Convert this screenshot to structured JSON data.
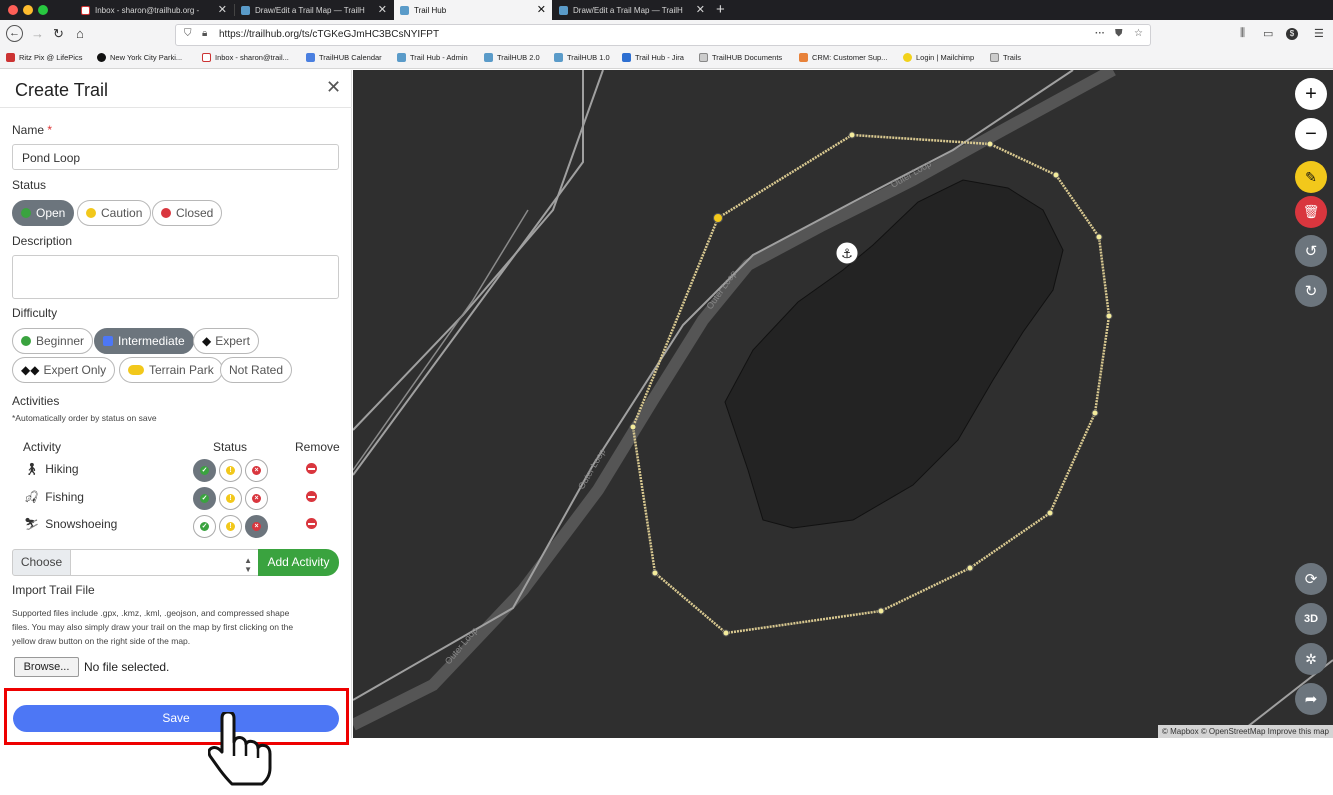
{
  "browser": {
    "tabs": [
      {
        "title": "Inbox - sharon@trailhub.org - "
      },
      {
        "title": "Draw/Edit a Trail Map — TrailH"
      },
      {
        "title": "Trail Hub"
      },
      {
        "title": "Draw/Edit a Trail Map — TrailH"
      }
    ],
    "url": "https://trailhub.org/ts/cTGKeGJmHC3BCsNYIFPT",
    "bookmarks": [
      "Ritz Pix @ LifePics",
      "New York City Parki...",
      "Inbox - sharon@trail...",
      "TrailHUB Calendar",
      "Trail Hub - Admin",
      "TrailHUB 2.0",
      "TrailHUB 1.0",
      "Trail Hub - Jira",
      "TrailHUB Documents",
      "CRM: Customer Sup...",
      "Login | Mailchimp",
      "Trails"
    ]
  },
  "panel": {
    "title": "Create Trail",
    "name_label": "Name",
    "name_required": "*",
    "name_value": "Pond Loop",
    "status_label": "Status",
    "status_options": [
      "Open",
      "Caution",
      "Closed"
    ],
    "status_selected": "Open",
    "description_label": "Description",
    "difficulty_label": "Difficulty",
    "difficulty_options": [
      "Beginner",
      "Intermediate",
      "Expert",
      "Expert Only",
      "Terrain Park",
      "Not Rated"
    ],
    "difficulty_selected": "Intermediate",
    "activities_label": "Activities",
    "activities_note": "*Automatically order by status on save",
    "activity_headers": {
      "activity": "Activity",
      "status": "Status",
      "remove": "Remove"
    },
    "activities": [
      {
        "name": "Hiking",
        "status": "open"
      },
      {
        "name": "Fishing",
        "status": "open"
      },
      {
        "name": "Snowshoeing",
        "status": "closed"
      }
    ],
    "choose_label": "Choose",
    "add_activity_label": "Add Activity",
    "import_label": "Import Trail File",
    "import_help_1": "Supported files include .gpx, .kmz, .kml, .geojson, and compressed shape",
    "import_help_2": "files. You may also simply draw your trail on the map by first clicking on the",
    "import_help_3": "yellow draw button on the right side of the map.",
    "browse_label": "Browse...",
    "no_file": "No file selected.",
    "save_label": "Save"
  },
  "map": {
    "trail_label": "Outer Loop",
    "attribution": "© Mapbox © OpenStreetMap Improve this map",
    "controls": [
      "zoom-in",
      "zoom-out",
      "draw",
      "delete",
      "undo",
      "redo",
      "rotate",
      "3D",
      "locate",
      "share"
    ],
    "control_3d_label": "3D"
  },
  "colors": {
    "open": "#3aa33f",
    "caution": "#f2c81b",
    "closed": "#d9363e",
    "intermediate": "#4d77f5",
    "trail_line": "#d8c890",
    "draw_button": "#f2c81b",
    "delete_button": "#d9363e"
  }
}
